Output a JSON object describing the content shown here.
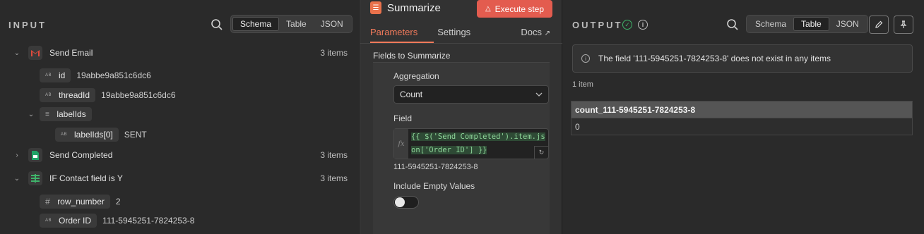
{
  "input": {
    "title": "INPUT",
    "view_tabs": [
      "Schema",
      "Table",
      "JSON"
    ],
    "active_view": "Schema",
    "nodes": [
      {
        "name": "Send Email",
        "count": "3 items",
        "fields": [
          {
            "name": "id",
            "value": "19abbe9a851c6dc6"
          },
          {
            "name": "threadId",
            "value": "19abbe9a851c6dc6"
          }
        ],
        "array_field": {
          "name": "labelIds",
          "child_name": "labelIds[0]",
          "child_value": "SENT"
        }
      },
      {
        "name": "Send Completed",
        "count": "3 items"
      },
      {
        "name": "IF Contact field is Y",
        "count": "3 items",
        "fields": [
          {
            "name": "row_number",
            "value": "2"
          },
          {
            "name": "Order ID",
            "value": "111-5945251-7824253-8"
          }
        ]
      }
    ]
  },
  "node": {
    "title": "Summarize",
    "execute_label": "Execute step",
    "tabs": [
      "Parameters",
      "Settings"
    ],
    "docs_label": "Docs",
    "section_title": "Fields to Summarize",
    "aggregation_label": "Aggregation",
    "aggregation_value": "Count",
    "field_label": "Field",
    "field_expression": "{{ $('Send Completed').item.json['Order ID'] }}",
    "field_result": "111-5945251-7824253-8",
    "include_empty_label": "Include Empty Values",
    "include_empty_on": false
  },
  "output": {
    "title": "OUTPUT",
    "view_tabs": [
      "Schema",
      "Table",
      "JSON"
    ],
    "active_view": "Table",
    "notice": "The field '111-5945251-7824253-8' does not exist in any items",
    "item_count": "1 item",
    "table": {
      "columns": [
        "count_111-5945251-7824253-8"
      ],
      "rows": [
        [
          "0"
        ]
      ]
    }
  },
  "colors": {
    "accent": "#f27a5b",
    "execute": "#e35c4f",
    "success": "#3fb46a",
    "expression": "#8fd69a"
  }
}
